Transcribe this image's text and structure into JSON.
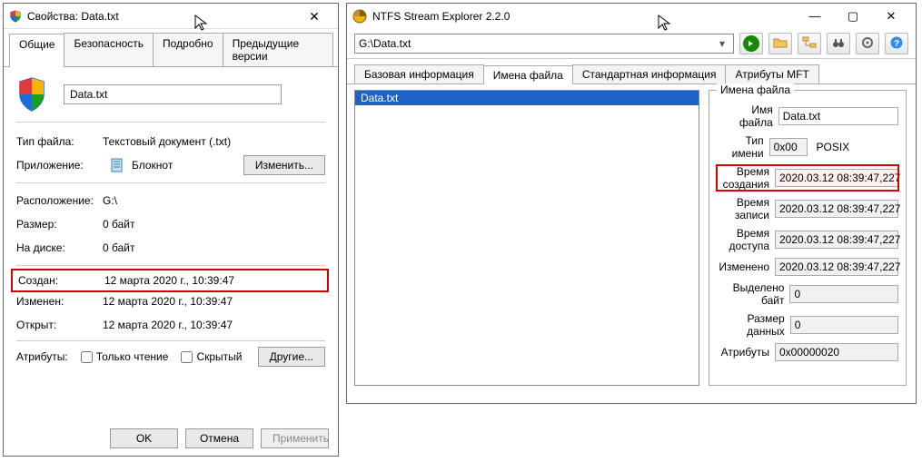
{
  "props": {
    "title": "Свойства: Data.txt",
    "tabs": [
      "Общие",
      "Безопасность",
      "Подробно",
      "Предыдущие версии"
    ],
    "active_tab": 0,
    "name": "Data.txt",
    "rows": {
      "file_type_label": "Тип файла:",
      "file_type_value": "Текстовый документ (.txt)",
      "app_label": "Приложение:",
      "app_value": "Блокнот",
      "change_btn": "Изменить...",
      "location_label": "Расположение:",
      "location_value": "G:\\",
      "size_label": "Размер:",
      "size_value": "0 байт",
      "ondisk_label": "На диске:",
      "ondisk_value": "0 байт",
      "created_label": "Создан:",
      "created_value": "12 марта 2020 г., 10:39:47",
      "modified_label": "Изменен:",
      "modified_value": "12 марта 2020 г., 10:39:47",
      "opened_label": "Открыт:",
      "opened_value": "12 марта 2020 г., 10:39:47",
      "attributes_label": "Атрибуты:",
      "readonly_label": "Только чтение",
      "hidden_label": "Скрытый",
      "other_btn": "Другие..."
    },
    "footer": {
      "ok": "OK",
      "cancel": "Отмена",
      "apply": "Применить"
    }
  },
  "explorer": {
    "title": "NTFS Stream Explorer 2.2.0",
    "path": "G:\\Data.txt",
    "tabs": [
      "Базовая информация",
      "Имена файла",
      "Стандартная информация",
      "Атрибуты MFT"
    ],
    "active_tab": 1,
    "list": [
      "Data.txt"
    ],
    "panel": {
      "legend": "Имена файла",
      "rows": [
        {
          "label": "Имя файла",
          "value": "Data.txt",
          "editable": true
        },
        {
          "label": "Тип имени",
          "value": "0x00",
          "posix": "POSIX"
        },
        {
          "label": "Время создания",
          "value": "2020.03.12 08:39:47,227",
          "highlight": true
        },
        {
          "label": "Время записи",
          "value": "2020.03.12 08:39:47,227"
        },
        {
          "label": "Время доступа",
          "value": "2020.03.12 08:39:47,227"
        },
        {
          "label": "Изменено",
          "value": "2020.03.12 08:39:47,227"
        },
        {
          "label": "Выделено байт",
          "value": "0"
        },
        {
          "label": "Размер данных",
          "value": "0"
        },
        {
          "label": "Атрибуты",
          "value": "0x00000020"
        }
      ]
    }
  }
}
